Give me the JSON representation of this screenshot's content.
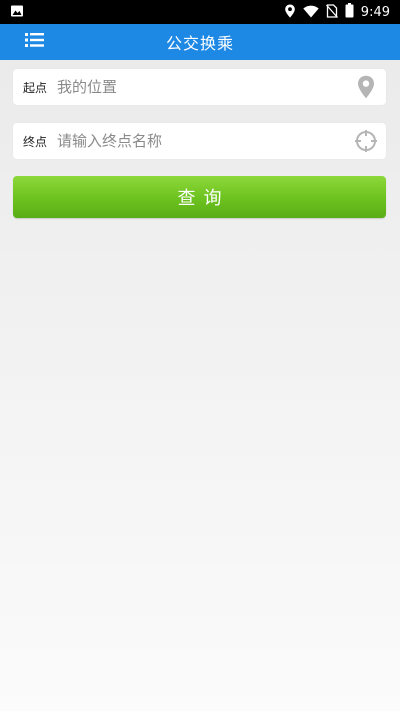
{
  "status_bar": {
    "time": "9:49",
    "icons": [
      "image-icon",
      "location-icon",
      "wifi-icon",
      "no-sim-icon",
      "battery-icon"
    ]
  },
  "app_bar": {
    "title": "公交换乘",
    "menu_icon": "list-menu-icon",
    "color": "#1e88e5"
  },
  "form": {
    "start": {
      "label": "起点",
      "placeholder": "我的位置",
      "icon": "map-pin-icon"
    },
    "end": {
      "label": "终点",
      "placeholder": "请输入终点名称",
      "icon": "crosshair-icon"
    },
    "query_label": "查询",
    "query_color": "#6cc21f"
  }
}
